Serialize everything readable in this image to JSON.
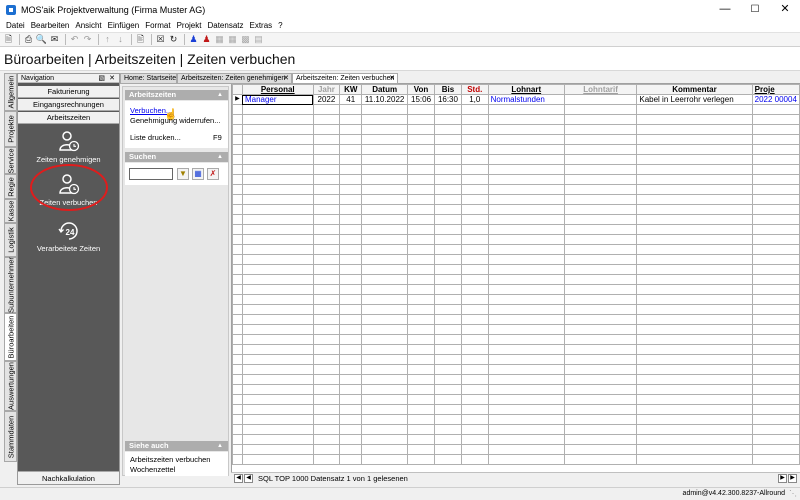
{
  "window": {
    "title": "MOS'aik Projektverwaltung (Firma Muster AG)"
  },
  "menu": [
    "Datei",
    "Bearbeiten",
    "Ansicht",
    "Einfügen",
    "Format",
    "Projekt",
    "Datensatz",
    "Extras",
    "?"
  ],
  "page_title": "Büroarbeiten | Arbeitszeiten | Zeiten verbuchen",
  "vertical_tabs": [
    "Allgemein",
    "Projekte",
    "Service",
    "Regie",
    "Kasse",
    "Logistik",
    "Subunternehmer",
    "Büroarbeiten",
    "Auswertungen",
    "Stammdaten"
  ],
  "navigation": {
    "header": "Navigation",
    "buttons": [
      "Fakturierung",
      "Eingangsrechnungen",
      "Arbeitszeiten"
    ],
    "items": [
      {
        "label": "Zeiten genehmigen",
        "icon": "user-clock-icon"
      },
      {
        "label": "Zeiten verbuchen",
        "icon": "user-clock-icon"
      },
      {
        "label": "Verarbeitete Zeiten",
        "icon": "clock-24-icon",
        "badge": "24"
      }
    ],
    "footer": "Nachkalkulation"
  },
  "task_pane": {
    "arbeitszeiten": {
      "header": "Arbeitszeiten",
      "links": [
        "Verbuchen...",
        "Genehmigung widerrufen...",
        "Liste drucken..."
      ],
      "shortcut": "F9"
    },
    "suchen": {
      "header": "Suchen",
      "value": ""
    },
    "siehe_auch": {
      "header": "Siehe auch",
      "links": [
        "Arbeitszeiten verbuchen",
        "Wochenzettel"
      ]
    }
  },
  "tabs": [
    "Home: Startseite",
    "Arbeitszeiten: Zeiten genehmigen",
    "Arbeitszeiten: Zeiten verbuchen"
  ],
  "grid": {
    "columns": [
      "Personal",
      "Jahr",
      "KW",
      "Datum",
      "Von",
      "Bis",
      "Std.",
      "Lohnart",
      "Lohntarif",
      "Kommentar",
      "Proje"
    ],
    "rows": [
      [
        "Manager",
        "2022",
        "41",
        "11.10.2022",
        "15:06",
        "16:30",
        "1,0",
        "Normalstunden",
        "",
        "Kabel in Leerrohr verlegen",
        "2022 00004"
      ]
    ]
  },
  "statusbar": {
    "text": "SQL TOP 1000 Datensatz 1 von 1 gelesenen"
  },
  "footer": {
    "text": "admin@v4.42.300.8237-Allround"
  },
  "colors": {
    "accent_red": "#e01c1c",
    "link_blue": "#0000ee",
    "nav_dark": "#585858",
    "header_red": "#c00000"
  }
}
